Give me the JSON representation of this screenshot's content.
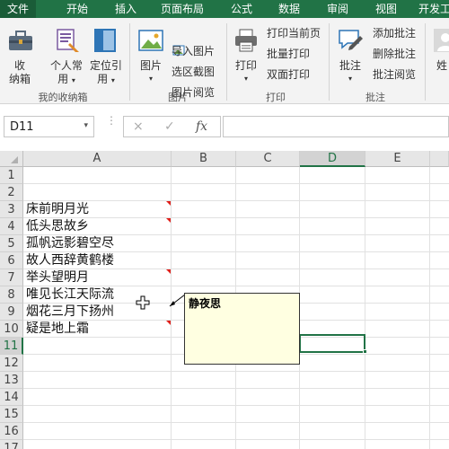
{
  "tabs": [
    {
      "label": "文件",
      "active": true
    },
    {
      "label": "开始"
    },
    {
      "label": "插入"
    },
    {
      "label": "页面布局"
    },
    {
      "label": "公式"
    },
    {
      "label": "数据"
    },
    {
      "label": "审阅"
    },
    {
      "label": "视图"
    },
    {
      "label": "开发工"
    }
  ],
  "ribbon": {
    "favorites": {
      "collect_label": "收",
      "collect_label2": "纳箱",
      "personal_label": "个人常",
      "personal_label2": "用",
      "locate_label": "定位引",
      "locate_label2": "用",
      "group_label": "我的收纳箱"
    },
    "picture": {
      "picture_label": "图片",
      "import_label": "导入图片",
      "screenshot_label": "选区截图",
      "browse_label": "图片阅览",
      "group_label": "图片"
    },
    "print": {
      "print_label": "打印",
      "print_current_label": "打印当前页",
      "batch_print_label": "批量打印",
      "duplex_label": "双面打印",
      "group_label": "打印"
    },
    "comment": {
      "comment_label": "批注",
      "add_label": "添加批注",
      "delete_label": "删除批注",
      "browse_label": "批注阅览",
      "group_label": "批注"
    },
    "cut_label": "姓"
  },
  "formula_bar": {
    "name_box_value": "D11",
    "cancel_icon": "×",
    "enter_icon": "✓",
    "fx_icon": "fx",
    "formula_value": ""
  },
  "grid": {
    "columns": [
      "A",
      "B",
      "C",
      "D",
      "E"
    ],
    "selected_column": "D",
    "rows": [
      "1",
      "2",
      "3",
      "4",
      "5",
      "6",
      "7",
      "8",
      "9",
      "10",
      "11",
      "12",
      "13",
      "14",
      "15",
      "16",
      "17"
    ],
    "selected_row": "11",
    "cells_A": {
      "2": "床前明月光",
      "3": "低头思故乡",
      "4": "孤帆远影碧空尽",
      "5": "故人西辞黄鹤楼",
      "6": "举头望明月",
      "7": "唯见长江天际流",
      "8": "烟花三月下扬州",
      "9": "疑是地上霜"
    },
    "comment_rows": [
      "2",
      "3",
      "6",
      "9"
    ]
  },
  "comment_box": {
    "text": "静夜思"
  },
  "colors": {
    "accent": "#217346",
    "comment_fill": "#ffffe1",
    "comment_indicator": "#e0201b"
  }
}
